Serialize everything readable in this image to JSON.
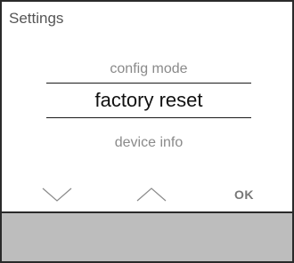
{
  "screen": {
    "title": "Settings"
  },
  "menu": {
    "previous_item": "config mode",
    "selected_item": "factory reset",
    "next_item": "device info"
  },
  "buttons": {
    "down_icon": "chevron-down",
    "up_icon": "chevron-up",
    "ok_label": "OK"
  },
  "colors": {
    "bezel": "#bdbdbd",
    "frame": "#2a2a2a",
    "inactive_text": "#8a8a8a",
    "selected_text": "#111111"
  }
}
